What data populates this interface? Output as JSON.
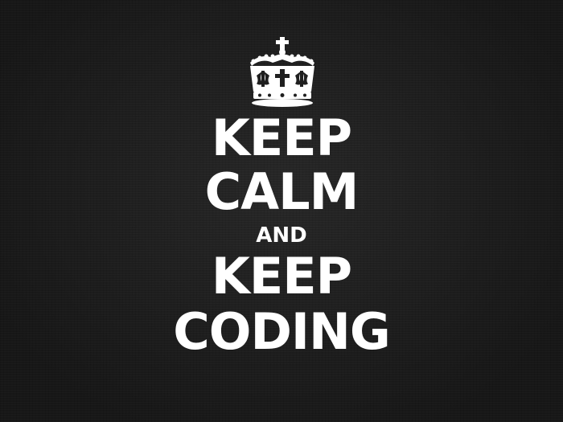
{
  "poster": {
    "lines": [
      "KEEP",
      "CALM",
      "AND",
      "KEEP",
      "CODING"
    ],
    "text_color": "#ffffff",
    "background_color": "#1f1f1f",
    "emblem": "crown-icon"
  }
}
